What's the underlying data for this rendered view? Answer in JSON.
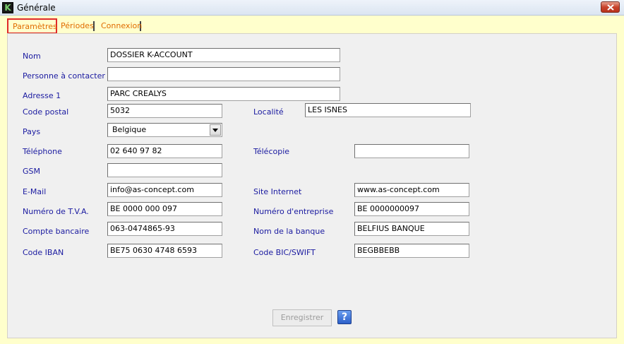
{
  "window": {
    "title": "Générale",
    "app_icon_letter": "K"
  },
  "tabs": [
    {
      "label": "Paramètres",
      "active": true
    },
    {
      "label": "Périodes",
      "active": false
    },
    {
      "label": "Connexion",
      "active": false
    }
  ],
  "form": {
    "nom": {
      "label": "Nom",
      "value": "DOSSIER K-ACCOUNT"
    },
    "personne": {
      "label": "Personne à contacter",
      "value": ""
    },
    "adresse": {
      "label": "Adresse 1",
      "value": "PARC CREALYS"
    },
    "code_postal": {
      "label": "Code postal",
      "value": "5032"
    },
    "localite": {
      "label": "Localité",
      "value": "LES ISNES"
    },
    "pays": {
      "label": "Pays",
      "value": "Belgique"
    },
    "telephone": {
      "label": "Téléphone",
      "value": "02 640 97 82"
    },
    "telecopie": {
      "label": "Télécopie",
      "value": ""
    },
    "gsm": {
      "label": "GSM",
      "value": ""
    },
    "email": {
      "label": "E-Mail",
      "value": "info@as-concept.com"
    },
    "site": {
      "label": "Site Internet",
      "value": "www.as-concept.com"
    },
    "tva": {
      "label": "Numéro de T.V.A.",
      "value": "BE 0000 000 097"
    },
    "entreprise": {
      "label": "Numéro  d'entreprise",
      "value": "BE 0000000097"
    },
    "compte": {
      "label": "Compte bancaire",
      "value": "063-0474865-93"
    },
    "banque": {
      "label": "Nom de la banque",
      "value": "BELFIUS BANQUE"
    },
    "iban": {
      "label": "Code IBAN",
      "value": "BE75 0630 4748 6593"
    },
    "bic": {
      "label": "Code BIC/SWIFT",
      "value": "BEGBBEBB"
    }
  },
  "buttons": {
    "save_label": "Enregistrer",
    "help_label": "?"
  },
  "colors": {
    "background": "#ffffcc",
    "tab_text": "#e06b00",
    "label_text": "#1a1aa0",
    "active_tab_border": "#e0282a"
  },
  "icons": {
    "close": "close-icon",
    "dropdown": "chevron-down-icon",
    "help": "help-icon"
  }
}
